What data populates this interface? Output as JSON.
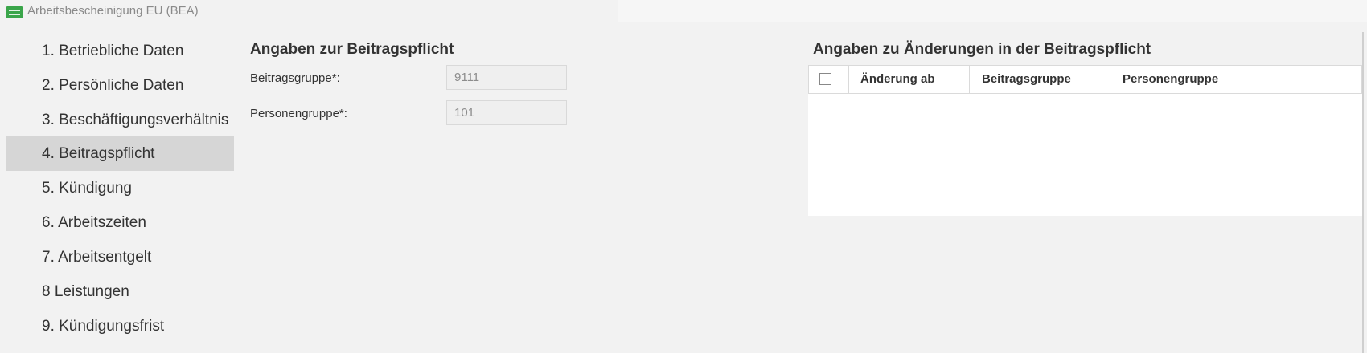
{
  "window": {
    "title": "Arbeitsbescheinigung EU (BEA)",
    "logo_icon": "datev-logo-icon",
    "logo_color": "#3aa54a"
  },
  "sidebar": {
    "items": [
      {
        "label": "1. Betriebliche Daten",
        "active": false
      },
      {
        "label": "2. Persönliche Daten",
        "active": false
      },
      {
        "label": "3. Beschäftigungsverhältnis",
        "active": false
      },
      {
        "label": "4. Beitragspflicht",
        "active": true
      },
      {
        "label": "5. Kündigung",
        "active": false
      },
      {
        "label": "6. Arbeitszeiten",
        "active": false
      },
      {
        "label": "7. Arbeitsentgelt",
        "active": false
      },
      {
        "label": "8 Leistungen",
        "active": false
      },
      {
        "label": "9. Kündigungsfrist",
        "active": false
      }
    ],
    "active_background": "#d6d6d6"
  },
  "beitragspflicht": {
    "title": "Angaben zur Beitragspflicht",
    "fields": {
      "beitragsgruppe": {
        "label": "Beitragsgruppe*:",
        "value": "9111"
      },
      "personengruppe": {
        "label": "Personengruppe*:",
        "value": "101"
      }
    }
  },
  "aenderungen": {
    "title": "Angaben zu Änderungen in der Beitragspflicht",
    "table": {
      "columns": [
        "Änderung ab",
        "Beitragsgruppe",
        "Personengruppe"
      ],
      "select_all_checked": false,
      "rows": []
    }
  }
}
